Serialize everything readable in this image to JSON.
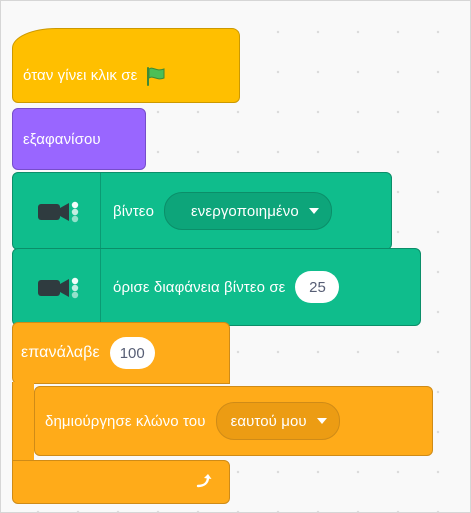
{
  "workspace": {
    "blocks": {
      "when_flag_clicked": {
        "label": "όταν γίνει κλικ σε",
        "icon": "green-flag-icon"
      },
      "hide": {
        "label": "εξαφανίσου"
      },
      "video_toggle": {
        "label": "βίντεο",
        "dropdown_value": "ενεργοποιημένο",
        "icon": "video-camera-icon"
      },
      "video_transparency": {
        "label": "όρισε διαφάνεια βίντεο σε",
        "value": "25",
        "icon": "video-camera-icon"
      },
      "repeat": {
        "label": "επανάλαβε",
        "value": "100",
        "end_icon": "loop-arrow-icon"
      },
      "create_clone": {
        "label": "δημιούργησε κλώνο του",
        "dropdown_value": "εαυτού μου"
      }
    },
    "colors": {
      "events": "#ffbf00",
      "looks": "#9966ff",
      "video_extension": "#0fbd8c",
      "control": "#ffab19",
      "flag_green": "#4cbf56"
    }
  }
}
